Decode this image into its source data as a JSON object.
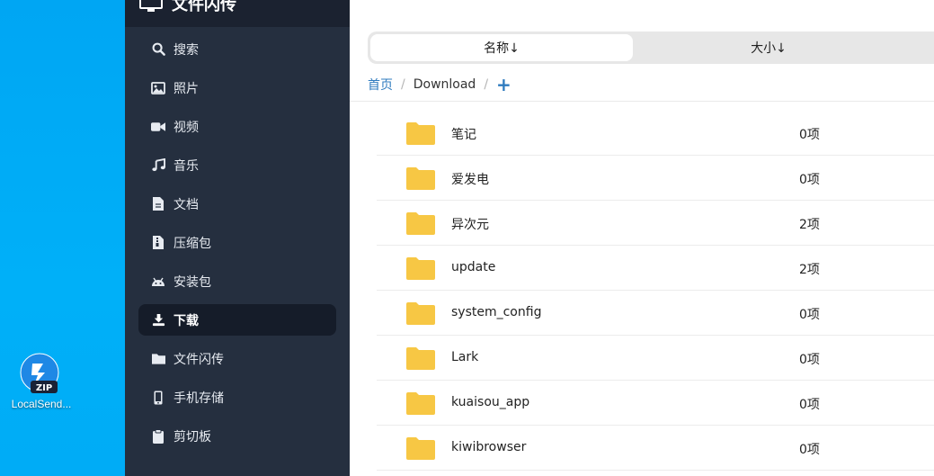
{
  "desktop": {
    "icon_label": "LocalSend...",
    "icon_badge": "ZIP"
  },
  "sidebar": {
    "title": "文件闪传",
    "items": [
      {
        "label": "搜索",
        "icon": "search-icon"
      },
      {
        "label": "照片",
        "icon": "image-icon"
      },
      {
        "label": "视频",
        "icon": "video-icon"
      },
      {
        "label": "音乐",
        "icon": "music-icon"
      },
      {
        "label": "文档",
        "icon": "document-icon"
      },
      {
        "label": "压缩包",
        "icon": "archive-icon"
      },
      {
        "label": "安装包",
        "icon": "android-icon"
      },
      {
        "label": "下载",
        "icon": "download-icon",
        "active": true
      },
      {
        "label": "文件闪传",
        "icon": "folder-icon"
      },
      {
        "label": "手机存储",
        "icon": "phone-icon"
      },
      {
        "label": "剪切板",
        "icon": "clipboard-icon"
      }
    ]
  },
  "sort": {
    "name_label": "名称↓",
    "size_label": "大小↓"
  },
  "breadcrumb": {
    "home": "首页",
    "separator": "/",
    "current": "Download",
    "add": "+"
  },
  "files": [
    {
      "name": "笔记",
      "count": "0项"
    },
    {
      "name": "爱发电",
      "count": "0项"
    },
    {
      "name": "异次元",
      "count": "2项"
    },
    {
      "name": "update",
      "count": "2项"
    },
    {
      "name": "system_config",
      "count": "0项"
    },
    {
      "name": "Lark",
      "count": "0项"
    },
    {
      "name": "kuaisou_app",
      "count": "0项"
    },
    {
      "name": "kiwibrowser",
      "count": "0项"
    }
  ],
  "colors": {
    "sidebar_bg": "#252f3f",
    "sidebar_active": "#151c29",
    "link": "#2f7bbf",
    "folder": "#f7c744",
    "desktop": "#00aaf5"
  }
}
